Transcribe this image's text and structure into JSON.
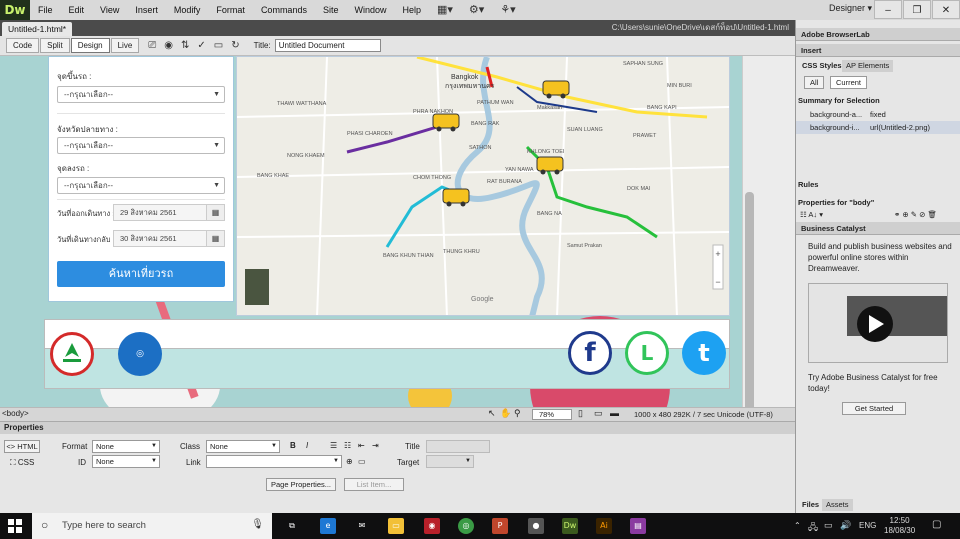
{
  "menubar": {
    "logo": "Dw",
    "items": [
      "File",
      "Edit",
      "View",
      "Insert",
      "Modify",
      "Format",
      "Commands",
      "Site",
      "Window",
      "Help"
    ],
    "workspace": "Designer ▾"
  },
  "document": {
    "tab": "Untitled-1.html*",
    "path": "C:\\Users\\sunie\\OneDrive\\เดสก์ท็อป\\Untitled-1.html"
  },
  "view_toolbar": {
    "buttons": [
      "Code",
      "Split",
      "Design",
      "Live"
    ],
    "active": "Design",
    "title_label": "Title:",
    "title_value": "Untitled Document"
  },
  "form": {
    "origin_label": "จุดขึ้นรถ :",
    "origin_value": "--กรุณาเลือก--",
    "dest_province_label": "จังหวัดปลายทาง :",
    "dest_province_value": "--กรุณาเลือก--",
    "dropoff_label": "จุดลงรถ :",
    "dropoff_value": "--กรุณาเลือก--",
    "depart_label": "วันที่ออกเดินทาง :",
    "depart_value": "29 สิงหาคม 2561",
    "return_label": "วันที่เดินทางกลับ :",
    "return_value": "30 สิงหาคม 2561",
    "search_button": "ค้นหาเที่ยวรถ"
  },
  "map": {
    "labels": [
      "Bangkok",
      "กรุงเทพมหานคร",
      "PATHUM WAN",
      "SAPHAN SUNG",
      "Makkasan",
      "BANG RAK",
      "SATHON",
      "BANG KAPI",
      "BANG NA",
      "PRAWET",
      "SUAN LUANG",
      "PHRA NAKHON",
      "NONG KHAEM",
      "CHOM THONG",
      "RAT BURANA",
      "BANG KHAE",
      "BANG KHUN THIAN",
      "THUNG KHRU",
      "Samut Prakan",
      "DOK MAI",
      "PHASI CHAROEN",
      "YAN NAWA",
      "KHLONG TOEI",
      "MIN BURI",
      "THAWI WATTHANA",
      "Google"
    ]
  },
  "social": {
    "facebook": "f",
    "line": "L",
    "twitter": "t"
  },
  "statusbar": {
    "tag": "<body>",
    "zoom": "78%",
    "size": "1000 x 480",
    "weight": "292K / 7 sec",
    "encoding": "Unicode (UTF-8)"
  },
  "properties": {
    "header": "Properties",
    "html_btn": "<> HTML",
    "css_btn": "CSS",
    "format_label": "Format",
    "format_value": "None",
    "id_label": "ID",
    "id_value": "None",
    "class_label": "Class",
    "class_value": "None",
    "link_label": "Link",
    "title_label": "Title",
    "target_label": "Target",
    "page_props": "Page Properties...",
    "list_item": "List Item..."
  },
  "right_panel": {
    "browserlab": "Adobe BrowserLab",
    "insert": "Insert",
    "tab_css": "CSS Styles",
    "tab_ap": "AP Elements",
    "btn_all": "All",
    "btn_current": "Current",
    "summary": "Summary for Selection",
    "rows": [
      {
        "k": "background-a...",
        "v": "fixed"
      },
      {
        "k": "background-i...",
        "v": "url(Untitled-2.png)"
      }
    ],
    "rules": "Rules",
    "props_for": "Properties for \"body\"",
    "bc_head": "Business Catalyst",
    "bc_text": "Build and publish business websites and powerful online stores within Dreamweaver.",
    "bc_try": "Try Adobe Business Catalyst for free today!",
    "bc_start": "Get Started",
    "files": "Files",
    "assets": "Assets"
  },
  "taskbar": {
    "search_placeholder": "Type here to search",
    "lang": "ENG",
    "time": "12:50",
    "date": "18/08/30"
  }
}
